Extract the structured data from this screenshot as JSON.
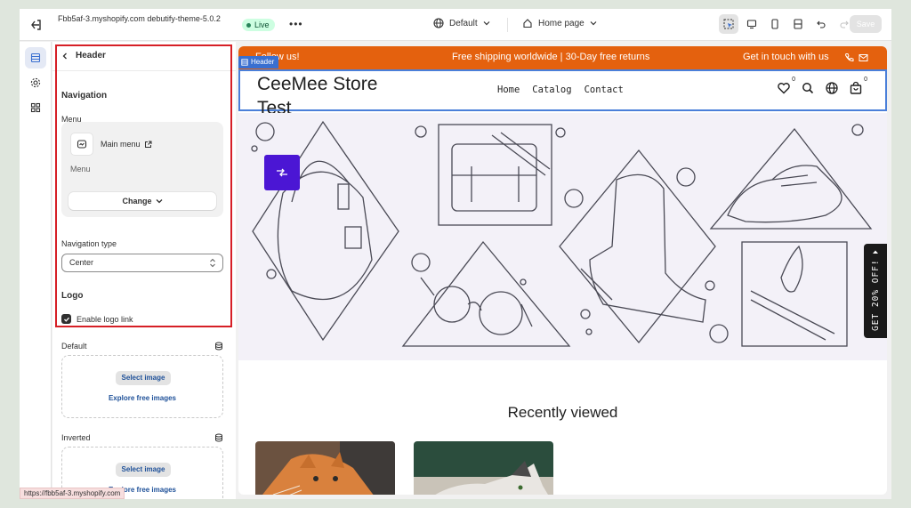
{
  "topbar": {
    "store_name": "Fbb5af-3.myshopify.com debutify-theme-5.0.2",
    "live_label": "Live",
    "more_label": "•••",
    "theme_selector": "Default",
    "page_selector": "Home page",
    "save_label": "Save",
    "tools": [
      "inspector-icon",
      "desktop-icon",
      "mobile-icon",
      "fullwidth-icon",
      "undo-icon",
      "redo-icon"
    ]
  },
  "rail": {
    "items": [
      "sections-icon",
      "theme-settings-icon",
      "app-embeds-icon"
    ]
  },
  "sidebar": {
    "title": "Header",
    "navigation_heading": "Navigation",
    "menu_label": "Menu",
    "menu_name": "Main menu",
    "menu_sub": "Menu",
    "change_label": "Change",
    "navigation_type_label": "Navigation type",
    "navigation_type_value": "Center",
    "logo_heading": "Logo",
    "enable_logo_link_label": "Enable logo link",
    "enable_logo_link_checked": true,
    "default_label": "Default",
    "inverted_label": "Inverted",
    "select_image_label": "Select image",
    "explore_label": "Explore free images"
  },
  "preview": {
    "announcement": {
      "left": "Follow us!",
      "center": "Free shipping worldwide | 30-Day free returns",
      "right": "Get in touch with us"
    },
    "header_tag": "Header",
    "logo_text": "CeeMee Store Test",
    "nav": [
      "Home",
      "Catalog",
      "Contact"
    ],
    "wishlist_count": "0",
    "cart_count": "0",
    "side_tab": "GET 20% OFF!",
    "recently_viewed": "Recently viewed"
  },
  "status_url": "https://fbb5af-3.myshopify.com",
  "colors": {
    "announcement_bg": "#e4610e",
    "selection_blue": "#4a7fd9",
    "highlight_red": "#d61f26",
    "fab": "#4b16d4"
  }
}
